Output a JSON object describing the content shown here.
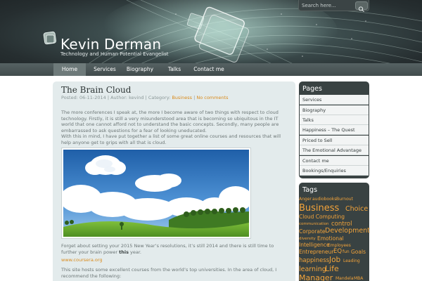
{
  "header": {
    "title": "Kevin Derman",
    "tagline": "Technology and Human Potential Evangelist",
    "search_placeholder": "Search here...",
    "icons": [
      "logo-cube-icon",
      "search-icon"
    ]
  },
  "nav": {
    "items": [
      {
        "label": "Home",
        "active": true
      },
      {
        "label": "Services",
        "active": false
      },
      {
        "label": "Biography",
        "active": false
      },
      {
        "label": "Talks",
        "active": false
      },
      {
        "label": "Contact me",
        "active": false
      }
    ]
  },
  "post": {
    "title": "The Brain Cloud",
    "meta_prefix": "Posted: 06-11-2014 | Author: kevind | Category: ",
    "category": "Business",
    "separator": " | ",
    "comments": "No comments",
    "para1": "The more conferences I speak at, the more I become aware of two things with respect to cloud technology. Firstly, it is still a very misunderstood area that is becoming so ubiquitous in the IT world that one cannot afford not to understand the basic concepts. Secondly, many people are embarrassed to ask questions for a fear of looking uneducated.",
    "para2": "With this in mind, I have put together a list of some great online courses and resources that will help anyone get to grips with all that is cloud.",
    "para3_before": "Forget about setting your 2015 New Year’s resolutions, it’s still 2014 and there is still time to further your brain power ",
    "para3_bold": "this",
    "para3_after": " year.",
    "link": "www.coursera.org",
    "para4": "This site hosts some excellent courses from the world’s top universities. In the area of cloud, I recommend the following:"
  },
  "sidebar": {
    "pages_title": "Pages",
    "pages": [
      "Services",
      "Biography",
      "Talks",
      "Happiness – The Quest",
      "Priced to Sell",
      "The Emotional Advantage",
      "Contact me",
      "Bookings/Enquiries"
    ],
    "tags_title": "Tags",
    "tags": [
      {
        "label": "Anger"
      },
      {
        "label": "audiobooks"
      },
      {
        "label": "Burnout"
      },
      {
        "label": "Business"
      },
      {
        "label": "Choice"
      },
      {
        "label": "Cloud Computing"
      },
      {
        "label": "communication"
      },
      {
        "label": "control"
      },
      {
        "label": "Corporate"
      },
      {
        "label": "Development"
      },
      {
        "label": "diversity"
      },
      {
        "label": "Emotional"
      },
      {
        "label": "Intelligence"
      },
      {
        "label": "Employees"
      },
      {
        "label": "Entrepreneur"
      },
      {
        "label": "EQ"
      },
      {
        "label": "fun"
      },
      {
        "label": "Goals"
      },
      {
        "label": "happiness"
      },
      {
        "label": "Job"
      },
      {
        "label": "Leading"
      },
      {
        "label": "learning"
      },
      {
        "label": "Life"
      },
      {
        "label": "Manager"
      },
      {
        "label": "Mandela"
      },
      {
        "label": "MBA"
      }
    ]
  },
  "colors": {
    "accent": "#d98a1b",
    "tag": "#f2a33a",
    "sidebar_bg": "#394242",
    "content_bg": "#e3ebec"
  }
}
